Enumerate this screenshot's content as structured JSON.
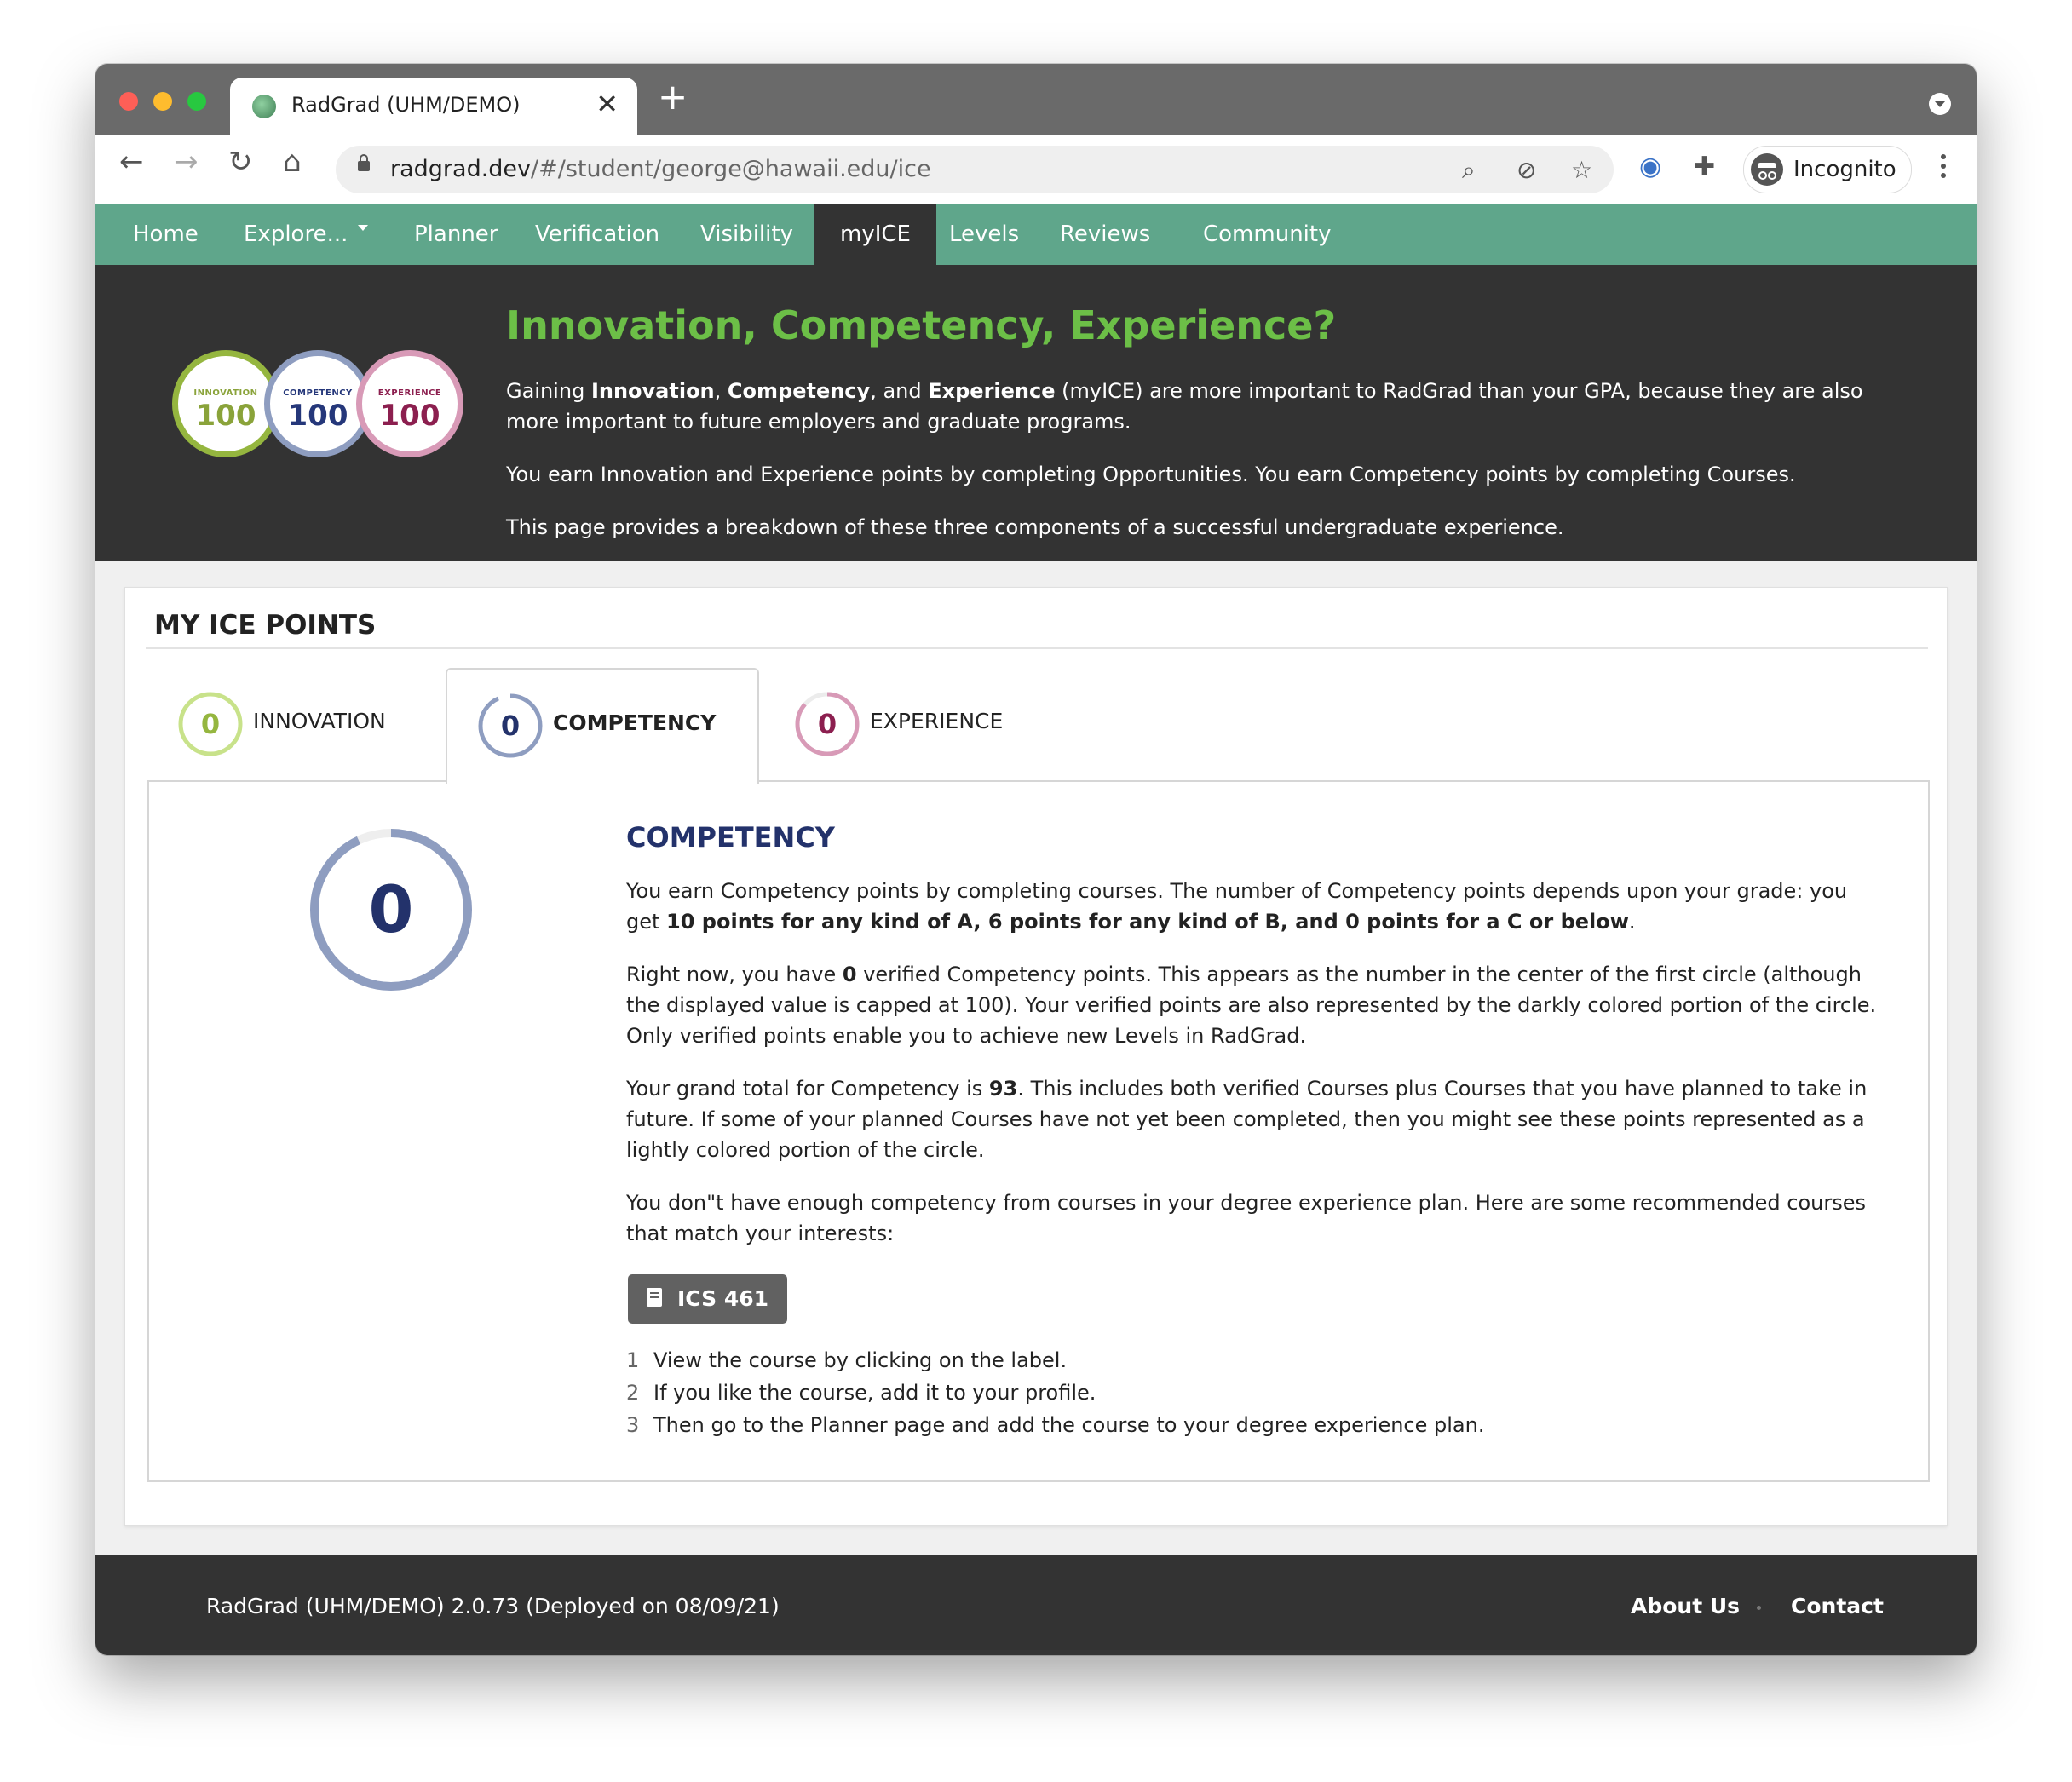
{
  "browser": {
    "tab_title": "RadGrad (UHM/DEMO)",
    "url_domain": "radgrad.dev",
    "url_path": "/#/student/george@hawaii.edu/ice",
    "profile_label": "Incognito"
  },
  "nav": {
    "items": [
      "Home",
      "Explore...",
      "Planner",
      "Verification",
      "Visibility",
      "myICE",
      "Levels",
      "Reviews",
      "Community"
    ],
    "active": "myICE"
  },
  "hero": {
    "title": "Innovation, Competency, Experience?",
    "para1_pre": "Gaining ",
    "para1_b1": "Innovation",
    "para1_s1": ", ",
    "para1_b2": "Competency",
    "para1_s2": ", and ",
    "para1_b3": "Experience",
    "para1_post": " (myICE) are more important to RadGrad than your GPA, because they are also more important to future employers and graduate programs.",
    "para2": "You earn Innovation and Experience points by completing Opportunities. You earn Competency points by completing Courses.",
    "para3": "This page provides a breakdown of these three components of a successful undergraduate experience.",
    "badges": [
      {
        "label": "INNOVATION",
        "value": "100",
        "color": "#8aa33a",
        "ring": "#95b63f"
      },
      {
        "label": "COMPETENCY",
        "value": "100",
        "color": "#25377a",
        "ring": "#8e9dc0"
      },
      {
        "label": "EXPERIENCE",
        "value": "100",
        "color": "#8c1f4f",
        "ring": "#d89ab7"
      }
    ]
  },
  "card": {
    "title": "MY ICE POINTS",
    "tabs": [
      {
        "label": "INNOVATION",
        "value": "0",
        "num_color": "#95b63f",
        "ring": "#c8e28a"
      },
      {
        "label": "COMPETENCY",
        "value": "0",
        "num_color": "#23326b",
        "ring": "#8e9dc0"
      },
      {
        "label": "EXPERIENCE",
        "value": "0",
        "num_color": "#8c1f4f",
        "ring": "#d89ab7"
      }
    ],
    "active_tab": "COMPETENCY"
  },
  "panel": {
    "big_value": "0",
    "heading": "COMPETENCY",
    "p1_pre": "You earn Competency points by completing courses. The number of Competency points depends upon your grade: you get ",
    "p1_bold": "10 points for any kind of A, 6 points for any kind of B, and 0 points for a C or below",
    "p1_post": ".",
    "p2_pre": "Right now, you have ",
    "p2_bold": "0",
    "p2_post": " verified Competency points. This appears as the number in the center of the first circle (although the displayed value is capped at 100). Your verified points are also represented by the darkly colored portion of the circle. Only verified points enable you to achieve new Levels in RadGrad.",
    "p3_pre": "Your grand total for Competency is ",
    "p3_bold": "93",
    "p3_post": ". This includes both verified Courses plus Courses that you have planned to take in future. If some of your planned Courses have not yet been completed, then you might see these points represented as a lightly colored portion of the circle.",
    "p4": "You don\"t have enough competency from courses in your degree experience plan. Here are some recommended courses that match your interests:",
    "course_label": "ICS 461",
    "steps": [
      {
        "n": "1",
        "text": "View the course by clicking on the label."
      },
      {
        "n": "2",
        "text": "If you like the course, add it to your profile."
      },
      {
        "n": "3",
        "text": "Then go to the Planner page and add the course to your degree experience plan."
      }
    ]
  },
  "footer": {
    "version": "RadGrad (UHM/DEMO) 2.0.73 (Deployed on 08/09/21)",
    "about": "About Us",
    "contact": "Contact"
  },
  "colors": {
    "nav_green": "#5fa68b",
    "hero_title": "#6cbf47",
    "dark": "#333333",
    "competency_blue": "#23326b"
  }
}
